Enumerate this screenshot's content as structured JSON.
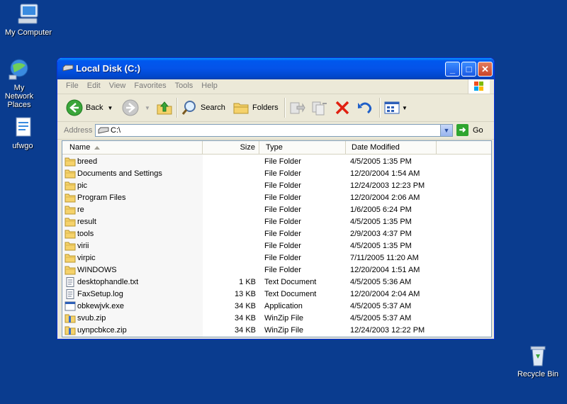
{
  "desktop": {
    "icons": [
      {
        "label": "My Computer",
        "icon": "my-computer-icon"
      },
      {
        "label": "My Network Places",
        "icon": "network-places-icon"
      },
      {
        "label": "ufwgo",
        "icon": "file-icon"
      },
      {
        "label": "Recycle Bin",
        "icon": "recycle-bin-icon"
      }
    ]
  },
  "window": {
    "title": "Local Disk (C:)",
    "menu": [
      "File",
      "Edit",
      "View",
      "Favorites",
      "Tools",
      "Help"
    ],
    "toolbar": {
      "back": "Back",
      "search": "Search",
      "folders": "Folders"
    },
    "address": {
      "label": "Address",
      "value": "C:\\",
      "go": "Go"
    },
    "columns": [
      "Name",
      "Size",
      "Type",
      "Date Modified"
    ],
    "rows": [
      {
        "name": "breed",
        "size": "",
        "type": "File Folder",
        "date": "4/5/2005 1:35 PM",
        "kind": "folder"
      },
      {
        "name": "Documents and Settings",
        "size": "",
        "type": "File Folder",
        "date": "12/20/2004 1:54 AM",
        "kind": "folder"
      },
      {
        "name": "pic",
        "size": "",
        "type": "File Folder",
        "date": "12/24/2003 12:23 PM",
        "kind": "folder"
      },
      {
        "name": "Program Files",
        "size": "",
        "type": "File Folder",
        "date": "12/20/2004 2:06 AM",
        "kind": "folder"
      },
      {
        "name": "re",
        "size": "",
        "type": "File Folder",
        "date": "1/6/2005 6:24 PM",
        "kind": "folder"
      },
      {
        "name": "result",
        "size": "",
        "type": "File Folder",
        "date": "4/5/2005 1:35 PM",
        "kind": "folder"
      },
      {
        "name": "tools",
        "size": "",
        "type": "File Folder",
        "date": "2/9/2003 4:37 PM",
        "kind": "folder"
      },
      {
        "name": "virii",
        "size": "",
        "type": "File Folder",
        "date": "4/5/2005 1:35 PM",
        "kind": "folder"
      },
      {
        "name": "virpic",
        "size": "",
        "type": "File Folder",
        "date": "7/11/2005 11:20 AM",
        "kind": "folder"
      },
      {
        "name": "WINDOWS",
        "size": "",
        "type": "File Folder",
        "date": "12/20/2004 1:51 AM",
        "kind": "folder"
      },
      {
        "name": "desktophandle.txt",
        "size": "1 KB",
        "type": "Text Document",
        "date": "4/5/2005 5:36 AM",
        "kind": "text"
      },
      {
        "name": "FaxSetup.log",
        "size": "13 KB",
        "type": "Text Document",
        "date": "12/20/2004 2:04 AM",
        "kind": "text"
      },
      {
        "name": "obkewjvk.exe",
        "size": "34 KB",
        "type": "Application",
        "date": "4/5/2005 5:37 AM",
        "kind": "exe"
      },
      {
        "name": "svub.zip",
        "size": "34 KB",
        "type": "WinZip File",
        "date": "4/5/2005 5:37 AM",
        "kind": "zip"
      },
      {
        "name": "uynpcbkce.zip",
        "size": "34 KB",
        "type": "WinZip File",
        "date": "12/24/2003 12:22 PM",
        "kind": "zip"
      }
    ]
  },
  "colors": {
    "desktop": "#0a3c8f",
    "titlebar": "#0453e8",
    "folder": "#f5d26b"
  }
}
